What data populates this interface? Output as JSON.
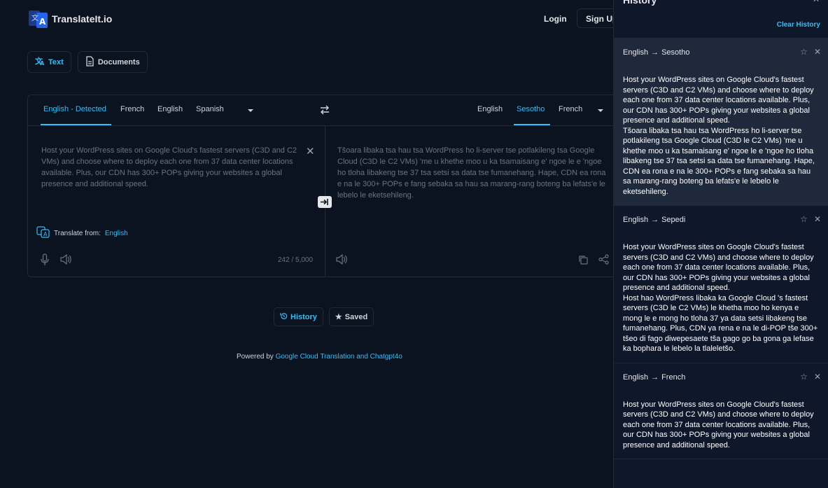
{
  "brand": {
    "name": "TranslateIt.io"
  },
  "nav": {
    "login": "Login",
    "signup": "Sign Up"
  },
  "modes": {
    "text": "Text",
    "documents": "Documents"
  },
  "source_langs": [
    "English - Detected",
    "French",
    "English",
    "Spanish"
  ],
  "target_langs": [
    "English",
    "Sesotho",
    "French"
  ],
  "source": {
    "text": "Host your WordPress sites on Google Cloud's fastest servers (C3D and C2 VMs) and choose where to deploy each one from 37 data center locations available. Plus, our CDN has 300+ POPs giving your websites a global presence and additional speed.",
    "translate_from_label": "Translate from:",
    "translate_from_lang": "English",
    "char_count": "242 / 5,000"
  },
  "target": {
    "text": "Tšoara libaka tsa hau tsa WordPress ho li-server tse potlakileng tsa Google Cloud (C3D le C2 VMs) 'me u khethe moo u ka tsamaisang e' ngoe le e 'ngoe ho tloha libakeng tse 37 tsa setsi sa data tse fumanehang. Hape, CDN ea rona e na le 300+ POPs e fang sebaka sa hau sa marang-rang boteng ba lefats'e le lebelo le eketsehileng."
  },
  "bottom": {
    "history": "History",
    "saved": "Saved"
  },
  "footer": {
    "prefix": "Powered by ",
    "link": "Google Cloud Translation and Chatgpt4o"
  },
  "history": {
    "title": "History",
    "clear": "Clear History",
    "items": [
      {
        "from": "English",
        "to": "Sesotho",
        "source": "Host your WordPress sites on Google Cloud's fastest servers (C3D and C2 VMs) and choose where to deploy each one from 37 data center locations available. Plus, our CDN has 300+ POPs giving your websites a global presence and additional speed.",
        "translation": "Tšoara libaka tsa hau tsa WordPress ho li-server tse potlakileng tsa Google Cloud (C3D le C2 VMs) 'me u khethe moo u ka tsamaisang e' ngoe le e 'ngoe ho tloha libakeng tse 37 tsa setsi sa data tse fumanehang. Hape, CDN ea rona e na le 300+ POPs e fang sebaka sa hau sa marang-rang boteng ba lefats'e le lebelo le eketsehileng."
      },
      {
        "from": "English",
        "to": "Sepedi",
        "source": "Host your WordPress sites on Google Cloud's fastest servers (C3D and C2 VMs) and choose where to deploy each one from 37 data center locations available. Plus, our CDN has 300+ POPs giving your websites a global presence and additional speed.",
        "translation": "Host hao WordPress libaka ka Google Cloud 's fastest servers (C3D le C2 VMs) le khetha moo ho kenya e mong le e mong ho tloha 37 ya data setsi libakeng tse fumanehang. Plus, CDN ya rena e na le di-POP tše 300+ tšeo di fago diwepesaete tša gago go ba gona ga lefase ka bophara le lebelo la tlaleletšo."
      },
      {
        "from": "English",
        "to": "French",
        "source": "Host your WordPress sites on Google Cloud's fastest servers (C3D and C2 VMs) and choose where to deploy each one from 37 data center locations available. Plus, our CDN has 300+ POPs giving your websites a global presence and additional speed.",
        "translation": ""
      }
    ]
  },
  "colors": {
    "accent": "#38bdf8",
    "background": "#0b1220",
    "panel": "#0f172a",
    "highlight": "#1e293b"
  },
  "icons": [
    "translate-icon",
    "document-icon",
    "swap-icon",
    "close-icon",
    "arrow-into-icon",
    "mic-icon",
    "speaker-icon",
    "copy-icon",
    "share-icon",
    "history-icon",
    "star-icon",
    "chevron-down-icon"
  ]
}
